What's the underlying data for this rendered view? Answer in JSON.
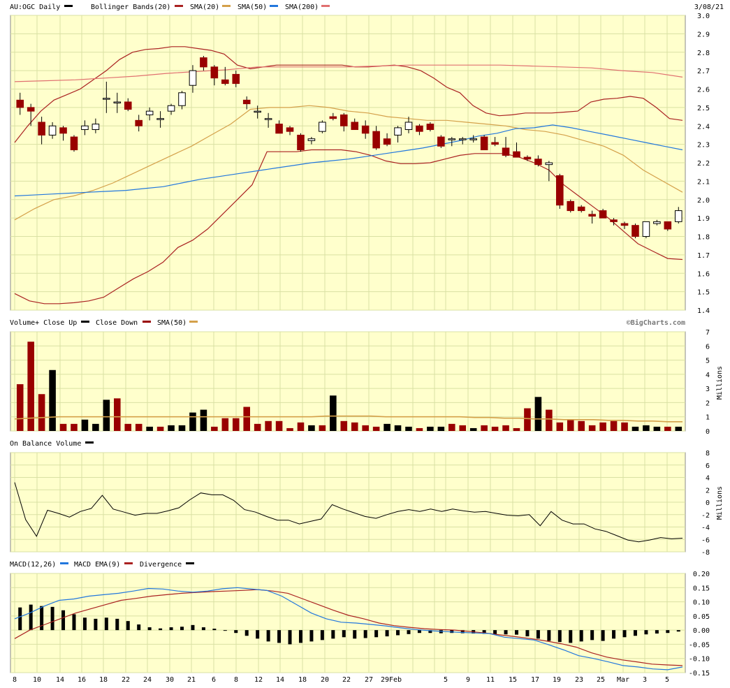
{
  "colors": {
    "plot_bg": "#ffffcc",
    "grid": "#d9e0a3",
    "up": "#000000",
    "down": "#990000",
    "sma20": "#aa2222",
    "sma50": "#d4a04a",
    "sma200": "#2277dd",
    "sma200_legend": "#e07070",
    "macd": "#2277dd",
    "macd_ema": "#aa2222",
    "vol_sma": "#d4a04a"
  },
  "header": {
    "symbol_label": "AU:OGC Daily",
    "legend_bb": "Bollinger Bands(20)",
    "legend_sma20": "SMA(20)",
    "legend_sma50": "SMA(50)",
    "legend_sma200": "SMA(200)",
    "date": "3/08/21"
  },
  "volume_panel": {
    "label_up": "Volume+ Close Up",
    "label_down": "Close Down",
    "label_sma": "SMA(50)",
    "units": "Millions",
    "watermark": "©BigCharts.com"
  },
  "obv_panel": {
    "label": "On Balance Volume",
    "units": "Millions"
  },
  "macd_panel": {
    "label": "MACD(12,26)",
    "label_ema": "MACD EMA(9)",
    "label_div": "Divergence"
  },
  "chart_data": [
    {
      "type": "candlestick",
      "title": "AU:OGC Daily",
      "ylim": [
        1.4,
        3.0
      ],
      "y_ticks": [
        "3.0",
        "2.9",
        "2.8",
        "2.7",
        "2.6",
        "2.5",
        "2.4",
        "2.3",
        "2.2",
        "2.1",
        "2.0",
        "1.9",
        "1.8",
        "1.7",
        "1.6",
        "1.5",
        "1.4"
      ],
      "x_ticks": [
        "8",
        "10",
        "14",
        "16",
        "18",
        "22",
        "24",
        "30",
        "21",
        "6",
        "8",
        "12",
        "14",
        "18",
        "20",
        "22",
        "27",
        "29Feb",
        "5",
        "9",
        "11",
        "15",
        "17",
        "19",
        "23",
        "25",
        "Mar",
        "3",
        "5"
      ],
      "ohlc": [
        [
          2.54,
          2.58,
          2.46,
          2.5
        ],
        [
          2.5,
          2.52,
          2.4,
          2.48
        ],
        [
          2.42,
          2.45,
          2.3,
          2.35
        ],
        [
          2.35,
          2.42,
          2.33,
          2.4
        ],
        [
          2.39,
          2.4,
          2.32,
          2.36
        ],
        [
          2.34,
          2.35,
          2.26,
          2.27
        ],
        [
          2.38,
          2.43,
          2.35,
          2.4
        ],
        [
          2.38,
          2.44,
          2.36,
          2.41
        ],
        [
          2.55,
          2.64,
          2.47,
          2.55
        ],
        [
          2.53,
          2.58,
          2.47,
          2.53
        ],
        [
          2.53,
          2.55,
          2.48,
          2.49
        ],
        [
          2.43,
          2.46,
          2.37,
          2.4
        ],
        [
          2.46,
          2.5,
          2.43,
          2.48
        ],
        [
          2.44,
          2.48,
          2.39,
          2.44
        ],
        [
          2.48,
          2.52,
          2.46,
          2.51
        ],
        [
          2.51,
          2.59,
          2.49,
          2.58
        ],
        [
          2.62,
          2.73,
          2.58,
          2.7
        ],
        [
          2.77,
          2.78,
          2.7,
          2.72
        ],
        [
          2.72,
          2.73,
          2.62,
          2.66
        ],
        [
          2.65,
          2.72,
          2.62,
          2.63
        ],
        [
          2.68,
          2.7,
          2.61,
          2.63
        ],
        [
          2.54,
          2.56,
          2.49,
          2.52
        ],
        [
          2.48,
          2.51,
          2.44,
          2.48
        ],
        [
          2.44,
          2.47,
          2.39,
          2.44
        ],
        [
          2.41,
          2.43,
          2.37,
          2.36
        ],
        [
          2.39,
          2.4,
          2.35,
          2.37
        ],
        [
          2.35,
          2.36,
          2.26,
          2.27
        ],
        [
          2.32,
          2.34,
          2.3,
          2.33
        ],
        [
          2.37,
          2.43,
          2.36,
          2.42
        ],
        [
          2.45,
          2.47,
          2.43,
          2.44
        ],
        [
          2.46,
          2.47,
          2.37,
          2.4
        ],
        [
          2.42,
          2.44,
          2.38,
          2.38
        ],
        [
          2.4,
          2.43,
          2.33,
          2.36
        ],
        [
          2.37,
          2.4,
          2.27,
          2.28
        ],
        [
          2.33,
          2.36,
          2.29,
          2.3
        ],
        [
          2.35,
          2.4,
          2.31,
          2.39
        ],
        [
          2.38,
          2.45,
          2.36,
          2.42
        ],
        [
          2.4,
          2.41,
          2.35,
          2.37
        ],
        [
          2.41,
          2.42,
          2.37,
          2.38
        ],
        [
          2.34,
          2.35,
          2.28,
          2.29
        ],
        [
          2.33,
          2.34,
          2.29,
          2.33
        ],
        [
          2.33,
          2.34,
          2.3,
          2.33
        ],
        [
          2.33,
          2.35,
          2.31,
          2.33
        ],
        [
          2.34,
          2.35,
          2.27,
          2.27
        ],
        [
          2.31,
          2.34,
          2.29,
          2.3
        ],
        [
          2.28,
          2.34,
          2.23,
          2.24
        ],
        [
          2.26,
          2.31,
          2.23,
          2.23
        ],
        [
          2.23,
          2.24,
          2.21,
          2.22
        ],
        [
          2.22,
          2.24,
          2.18,
          2.19
        ],
        [
          2.19,
          2.21,
          2.1,
          2.2
        ],
        [
          2.13,
          2.14,
          1.95,
          1.97
        ],
        [
          1.99,
          2.0,
          1.93,
          1.94
        ],
        [
          1.96,
          1.97,
          1.93,
          1.94
        ],
        [
          1.92,
          1.94,
          1.87,
          1.91
        ],
        [
          1.94,
          1.95,
          1.9,
          1.9
        ],
        [
          1.89,
          1.9,
          1.86,
          1.88
        ],
        [
          1.87,
          1.88,
          1.84,
          1.86
        ],
        [
          1.86,
          1.87,
          1.79,
          1.8
        ],
        [
          1.8,
          1.88,
          1.79,
          1.88
        ],
        [
          1.87,
          1.89,
          1.86,
          1.88
        ],
        [
          1.88,
          1.88,
          1.83,
          1.84
        ],
        [
          1.88,
          1.96,
          1.87,
          1.94
        ]
      ],
      "bb_upper": [
        2.31,
        2.4,
        2.48,
        2.54,
        2.57,
        2.6,
        2.65,
        2.7,
        2.76,
        2.8,
        2.815,
        2.82,
        2.83,
        2.83,
        2.82,
        2.81,
        2.79,
        2.73,
        2.71,
        2.72,
        2.73,
        2.73,
        2.73,
        2.73,
        2.73,
        2.73,
        2.72,
        2.72,
        2.725,
        2.73,
        2.72,
        2.7,
        2.66,
        2.61,
        2.58,
        2.51,
        2.47,
        2.455,
        2.46,
        2.47,
        2.47,
        2.47,
        2.475,
        2.48,
        2.53,
        2.545,
        2.55,
        2.56,
        2.55,
        2.5,
        2.44,
        2.43
      ],
      "bb_lower": [
        1.49,
        1.45,
        1.435,
        1.435,
        1.44,
        1.45,
        1.47,
        1.52,
        1.57,
        1.61,
        1.66,
        1.74,
        1.78,
        1.84,
        1.92,
        2.0,
        2.08,
        2.26,
        2.26,
        2.26,
        2.27,
        2.27,
        2.27,
        2.26,
        2.24,
        2.21,
        2.195,
        2.195,
        2.2,
        2.22,
        2.24,
        2.25,
        2.25,
        2.25,
        2.23,
        2.2,
        2.16,
        2.08,
        2.02,
        1.96,
        1.9,
        1.83,
        1.76,
        1.72,
        1.68,
        1.675
      ],
      "sma50": [
        1.89,
        1.95,
        2.0,
        2.02,
        2.05,
        2.09,
        2.14,
        2.19,
        2.24,
        2.29,
        2.35,
        2.41,
        2.49,
        2.5,
        2.5,
        2.51,
        2.5,
        2.48,
        2.47,
        2.45,
        2.44,
        2.43,
        2.43,
        2.42,
        2.41,
        2.4,
        2.38,
        2.37,
        2.35,
        2.32,
        2.29,
        2.24,
        2.16,
        2.1,
        2.04
      ],
      "sma200": [
        2.02,
        2.025,
        2.03,
        2.035,
        2.04,
        2.045,
        2.05,
        2.06,
        2.07,
        2.09,
        2.11,
        2.125,
        2.14,
        2.155,
        2.17,
        2.185,
        2.2,
        2.21,
        2.22,
        2.235,
        2.25,
        2.265,
        2.28,
        2.3,
        2.32,
        2.345,
        2.36,
        2.385,
        2.39,
        2.405,
        2.39,
        2.37,
        2.35,
        2.33,
        2.31,
        2.29,
        2.27
      ],
      "sma20": [
        2.64,
        2.645,
        2.65,
        2.66,
        2.67,
        2.685,
        2.695,
        2.705,
        2.72,
        2.72,
        2.72,
        2.72,
        2.725,
        2.73,
        2.73,
        2.73,
        2.73,
        2.725,
        2.72,
        2.715,
        2.7,
        2.69,
        2.665
      ]
    },
    {
      "type": "bar",
      "title": "Volume",
      "units": "Millions",
      "ylim": [
        0,
        7
      ],
      "y_ticks": [
        "7",
        "6",
        "5",
        "4",
        "3",
        "2",
        "1",
        "0"
      ],
      "values": [
        3.3,
        6.3,
        2.6,
        4.3,
        0.5,
        0.5,
        0.8,
        0.5,
        2.2,
        2.3,
        0.5,
        0.5,
        0.3,
        0.3,
        0.4,
        0.4,
        1.3,
        1.5,
        0.3,
        0.9,
        0.9,
        1.7,
        0.5,
        0.7,
        0.7,
        0.2,
        0.6,
        0.4,
        0.4,
        2.5,
        0.7,
        0.6,
        0.4,
        0.3,
        0.5,
        0.4,
        0.3,
        0.2,
        0.3,
        0.3,
        0.5,
        0.4,
        0.2,
        0.4,
        0.3,
        0.4,
        0.2,
        1.6,
        2.4,
        1.5,
        0.6,
        0.8,
        0.7,
        0.4,
        0.6,
        0.7,
        0.6,
        0.3,
        0.4,
        0.3,
        0.3,
        0.3
      ],
      "up_flags": [
        0,
        0,
        0,
        1,
        0,
        0,
        1,
        1,
        1,
        0,
        0,
        0,
        1,
        0,
        1,
        1,
        1,
        1,
        0,
        0,
        0,
        0,
        0,
        0,
        0,
        0,
        0,
        1,
        0,
        1,
        0,
        0,
        0,
        0,
        1,
        1,
        1,
        0,
        1,
        1,
        0,
        0,
        1,
        0,
        0,
        0,
        0,
        0,
        1,
        0,
        0,
        0,
        0,
        0,
        0,
        0,
        0,
        1,
        1,
        1,
        0,
        1
      ],
      "sma": [
        0.85,
        0.9,
        0.95,
        1.0,
        1.0,
        1.0,
        1.0,
        1.0,
        1.0,
        1.0,
        1.0,
        1.0,
        1.0,
        1.0,
        1.0,
        1.0,
        1.0,
        1.0,
        1.0,
        1.0,
        1.0,
        1.05,
        1.05,
        1.05,
        1.05,
        1.0,
        1.0,
        1.0,
        1.0,
        1.0,
        1.0,
        0.95,
        0.95,
        0.9,
        0.9,
        0.85,
        0.85,
        0.8,
        0.8,
        0.8,
        0.75,
        0.75,
        0.7,
        0.7,
        0.65,
        0.65
      ]
    },
    {
      "type": "line",
      "title": "On Balance Volume",
      "units": "Millions",
      "ylim": [
        -8,
        8
      ],
      "y_ticks": [
        "8",
        "6",
        "4",
        "2",
        "0",
        "-2",
        "-4",
        "-6",
        "-8"
      ],
      "values": [
        3.2,
        -2.8,
        -5.5,
        -1.3,
        -1.8,
        -2.4,
        -1.5,
        -1.0,
        1.1,
        -1.1,
        -1.6,
        -2.1,
        -1.8,
        -1.8,
        -1.4,
        -0.9,
        0.4,
        1.5,
        1.2,
        1.2,
        0.3,
        -1.2,
        -1.6,
        -2.3,
        -2.9,
        -2.9,
        -3.5,
        -3.1,
        -2.7,
        -0.4,
        -1.1,
        -1.7,
        -2.3,
        -2.6,
        -2.0,
        -1.5,
        -1.2,
        -1.5,
        -1.1,
        -1.5,
        -1.1,
        -1.4,
        -1.6,
        -1.5,
        -1.8,
        -2.1,
        -2.2,
        -2.0,
        -3.8,
        -1.5,
        -2.9,
        -3.5,
        -3.5,
        -4.3,
        -4.7,
        -5.4,
        -6.1,
        -6.4,
        -6.1,
        -5.7,
        -5.9,
        -5.8
      ]
    },
    {
      "type": "line",
      "title": "MACD(12,26)",
      "ylim": [
        -0.15,
        0.2
      ],
      "y_ticks": [
        "0.20",
        "0.15",
        "0.10",
        "0.05",
        "0.00",
        "-0.05",
        "-0.10",
        "-0.15"
      ],
      "macd": [
        0.04,
        0.06,
        0.085,
        0.105,
        0.11,
        0.12,
        0.125,
        0.13,
        0.138,
        0.147,
        0.145,
        0.138,
        0.134,
        0.138,
        0.146,
        0.15,
        0.145,
        0.14,
        0.12,
        0.09,
        0.06,
        0.04,
        0.028,
        0.025,
        0.02,
        0.015,
        0.008,
        0.002,
        -0.002,
        -0.005,
        -0.008,
        -0.01,
        -0.012,
        -0.025,
        -0.03,
        -0.035,
        -0.052,
        -0.07,
        -0.09,
        -0.1,
        -0.112,
        -0.125,
        -0.13,
        -0.137,
        -0.14,
        -0.13
      ],
      "macd_ema": [
        -0.03,
        0.0,
        0.02,
        0.04,
        0.06,
        0.075,
        0.09,
        0.105,
        0.112,
        0.12,
        0.125,
        0.13,
        0.133,
        0.136,
        0.138,
        0.14,
        0.143,
        0.138,
        0.13,
        0.11,
        0.09,
        0.07,
        0.052,
        0.04,
        0.025,
        0.016,
        0.01,
        0.005,
        0.002,
        0.0,
        -0.005,
        -0.01,
        -0.017,
        -0.023,
        -0.03,
        -0.038,
        -0.048,
        -0.06,
        -0.08,
        -0.095,
        -0.105,
        -0.112,
        -0.12,
        -0.123,
        -0.125
      ],
      "divergence": [
        0.08,
        0.09,
        0.085,
        0.082,
        0.07,
        0.056,
        0.044,
        0.04,
        0.044,
        0.04,
        0.032,
        0.02,
        0.01,
        0.006,
        0.01,
        0.012,
        0.018,
        0.01,
        0.005,
        0.0,
        -0.01,
        -0.02,
        -0.03,
        -0.04,
        -0.045,
        -0.05,
        -0.045,
        -0.04,
        -0.035,
        -0.03,
        -0.025,
        -0.03,
        -0.028,
        -0.025,
        -0.022,
        -0.018,
        -0.014,
        -0.01,
        -0.01,
        -0.011,
        -0.01,
        -0.011,
        -0.012,
        -0.013,
        -0.014,
        -0.015,
        -0.016,
        -0.022,
        -0.03,
        -0.038,
        -0.042,
        -0.045,
        -0.04,
        -0.035,
        -0.038,
        -0.03,
        -0.025,
        -0.02,
        -0.015,
        -0.012,
        -0.01,
        -0.005
      ]
    }
  ]
}
